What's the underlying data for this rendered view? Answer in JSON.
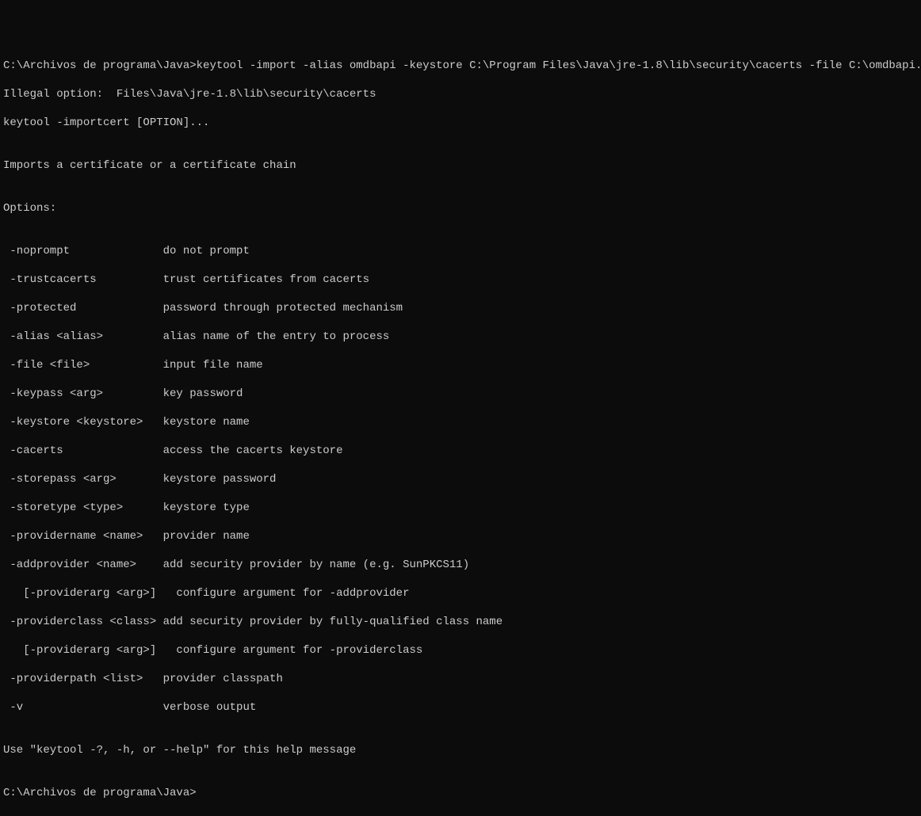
{
  "terminal": {
    "line01": "C:\\Archivos de programa\\Java>keytool -import -alias omdbapi -keystore C:\\Program Files\\Java\\jre-1.8\\lib\\security\\cacerts -file C:\\omdbapi.com",
    "line02": "Illegal option:  Files\\Java\\jre-1.8\\lib\\security\\cacerts",
    "line03": "keytool -importcert [OPTION]...",
    "line04": "",
    "line05": "Imports a certificate or a certificate chain",
    "line06": "",
    "line07": "Options:",
    "line08": "",
    "line09": " -noprompt              do not prompt",
    "line10": " -trustcacerts          trust certificates from cacerts",
    "line11": " -protected             password through protected mechanism",
    "line12": " -alias <alias>         alias name of the entry to process",
    "line13": " -file <file>           input file name",
    "line14": " -keypass <arg>         key password",
    "line15": " -keystore <keystore>   keystore name",
    "line16": " -cacerts               access the cacerts keystore",
    "line17": " -storepass <arg>       keystore password",
    "line18": " -storetype <type>      keystore type",
    "line19": " -providername <name>   provider name",
    "line20": " -addprovider <name>    add security provider by name (e.g. SunPKCS11)",
    "line21": "   [-providerarg <arg>]   configure argument for -addprovider",
    "line22": " -providerclass <class> add security provider by fully-qualified class name",
    "line23": "   [-providerarg <arg>]   configure argument for -providerclass",
    "line24": " -providerpath <list>   provider classpath",
    "line25": " -v                     verbose output",
    "line26": "",
    "line27": "Use \"keytool -?, -h, or --help\" for this help message",
    "line28": "",
    "line29": "C:\\Archivos de programa\\Java>"
  }
}
